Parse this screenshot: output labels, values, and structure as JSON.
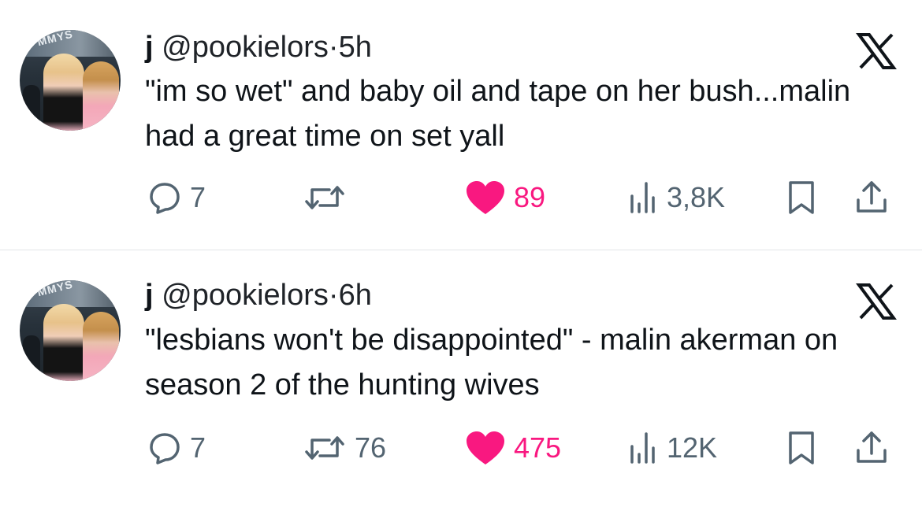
{
  "colors": {
    "like": "#f91880",
    "muted": "#536471",
    "text": "#0f1419",
    "divider": "#e3e5e8"
  },
  "tweets": [
    {
      "name": "j",
      "handle": "@pookielors",
      "separator": "·",
      "time": "5h",
      "text": "\"im so wet\" and baby oil and tape on her bush...malin had a great time on set yall",
      "avatar_banner_text": "MMYS",
      "replies": "7",
      "retweets": "",
      "likes": "89",
      "views": "3,8K",
      "icons": [
        "reply-icon",
        "retweet-icon",
        "heart-icon",
        "views-icon",
        "bookmark-icon",
        "share-icon",
        "x-logo-icon"
      ]
    },
    {
      "name": "j",
      "handle": "@pookielors",
      "separator": "·",
      "time": "6h",
      "text": "\"lesbians won't be disappointed\" - malin akerman on season 2 of the hunting wives",
      "avatar_banner_text": "MMYS",
      "replies": "7",
      "retweets": "76",
      "likes": "475",
      "views": "12K",
      "icons": [
        "reply-icon",
        "retweet-icon",
        "heart-icon",
        "views-icon",
        "bookmark-icon",
        "share-icon",
        "x-logo-icon"
      ]
    }
  ]
}
